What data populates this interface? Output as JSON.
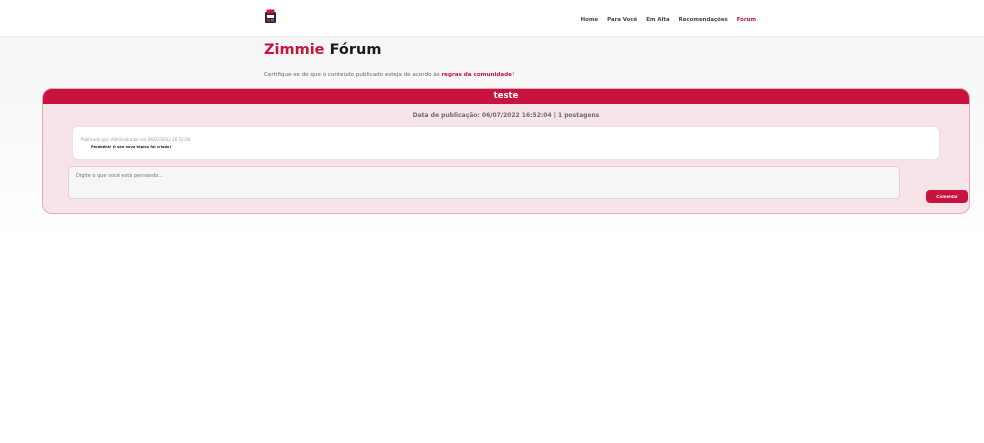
{
  "nav": {
    "links": [
      "Home",
      "Para Você",
      "Em Alta",
      "Recomendações",
      "Fórum"
    ],
    "active": "Fórum"
  },
  "page": {
    "title_brand": "Zimmie",
    "title_rest": "Fórum",
    "notice_prefix": "Certifique-se de que o conteúdo publicado esteja de acordo às",
    "notice_link": "regras da comunidade",
    "notice_suffix": "!"
  },
  "topic": {
    "title": "teste",
    "publication_info": "Data de publicação: 06/07/2022 16:52:04 | 1 postagens"
  },
  "post": {
    "meta": "Publicado por: Administrador em 06/07/2022 16:52:04",
    "body": "Parabéns! O seu novo tópico foi criado!"
  },
  "comment": {
    "placeholder": "Digite o que você está pensando...",
    "button_label": "Comentar"
  },
  "colors": {
    "accent": "#c8133f",
    "card_bg": "#f7e4e8"
  }
}
